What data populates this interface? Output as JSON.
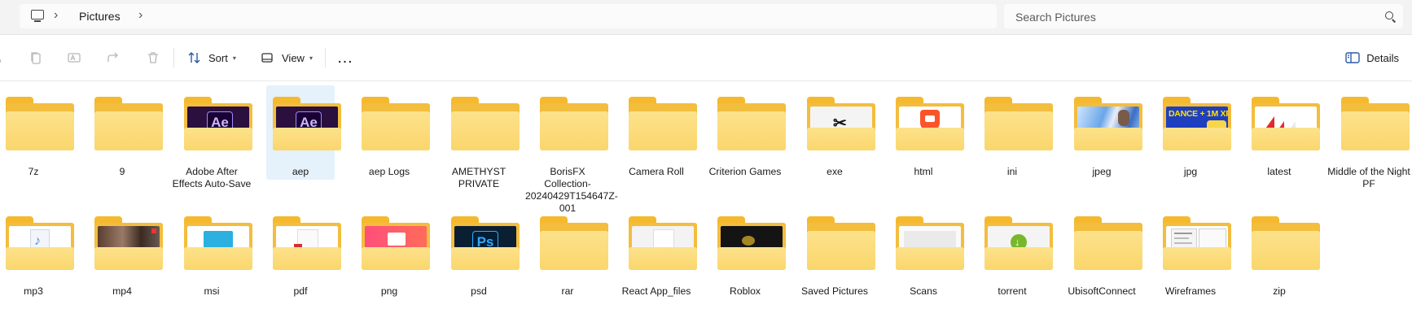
{
  "address_bar": {
    "breadcrumb": [
      "Pictures"
    ],
    "search_placeholder": "Search Pictures"
  },
  "command_bar": {
    "sort_label": "Sort",
    "view_label": "View",
    "more_label": "…",
    "details_label": "Details"
  },
  "folders_row1": [
    {
      "name": "7z",
      "thumb": "none"
    },
    {
      "name": "9",
      "thumb": "none"
    },
    {
      "name": "Adobe After Effects Auto-Save",
      "thumb": "ae"
    },
    {
      "name": "aep",
      "thumb": "ae",
      "selected": true
    },
    {
      "name": "aep Logs",
      "thumb": "none"
    },
    {
      "name": "AMETHYST PRIVATE",
      "thumb": "none"
    },
    {
      "name": "BorisFX Collection-20240429T154647Z-001",
      "thumb": "none"
    },
    {
      "name": "Camera Roll",
      "thumb": "none"
    },
    {
      "name": "Criterion Games",
      "thumb": "none"
    },
    {
      "name": "exe",
      "thumb": "capcut"
    },
    {
      "name": "html",
      "thumb": "brave"
    },
    {
      "name": "ini",
      "thumb": "none"
    },
    {
      "name": "jpeg",
      "thumb": "photo-blue"
    },
    {
      "name": "jpg",
      "thumb": "dance"
    },
    {
      "name": "latest",
      "thumb": "red-arrows"
    },
    {
      "name": "Middle of the Night PF",
      "thumb": "none"
    }
  ],
  "folders_row2": [
    {
      "name": "mp3",
      "thumb": "music"
    },
    {
      "name": "mp4",
      "thumb": "video-brown"
    },
    {
      "name": "msi",
      "thumb": "installer"
    },
    {
      "name": "pdf",
      "thumb": "pdf"
    },
    {
      "name": "png",
      "thumb": "pink"
    },
    {
      "name": "psd",
      "thumb": "ps"
    },
    {
      "name": "rar",
      "thumb": "none"
    },
    {
      "name": "React App_files",
      "thumb": "doc"
    },
    {
      "name": "Roblox",
      "thumb": "dark"
    },
    {
      "name": "Saved Pictures",
      "thumb": "none"
    },
    {
      "name": "Scans",
      "thumb": "scans"
    },
    {
      "name": "torrent",
      "thumb": "torrent"
    },
    {
      "name": "UbisoftConnect",
      "thumb": "none"
    },
    {
      "name": "Wireframes",
      "thumb": "wireframe"
    },
    {
      "name": "zip",
      "thumb": "none"
    }
  ]
}
